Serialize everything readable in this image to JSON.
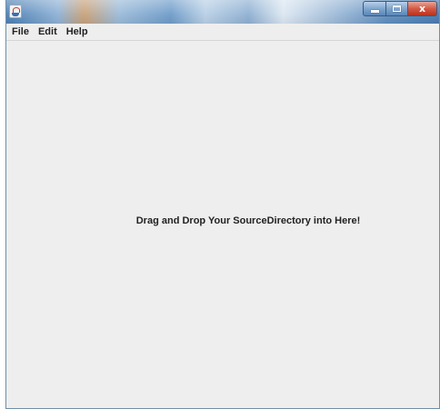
{
  "window": {
    "controls": {
      "minimize": "minimize",
      "maximize": "maximize",
      "close": "x"
    }
  },
  "menubar": {
    "items": [
      {
        "label": "File"
      },
      {
        "label": "Edit"
      },
      {
        "label": "Help"
      }
    ]
  },
  "main": {
    "drop_message": "Drag and Drop Your SourceDirectory into Here!"
  },
  "icons": {
    "app": "java-app-icon",
    "minimize": "minimize-icon",
    "maximize": "maximize-icon",
    "close": "close-icon"
  },
  "colors": {
    "content_background": "#eeeeee",
    "close_button": "#d45a45",
    "titlebar_accent": "#4c7fb4"
  }
}
